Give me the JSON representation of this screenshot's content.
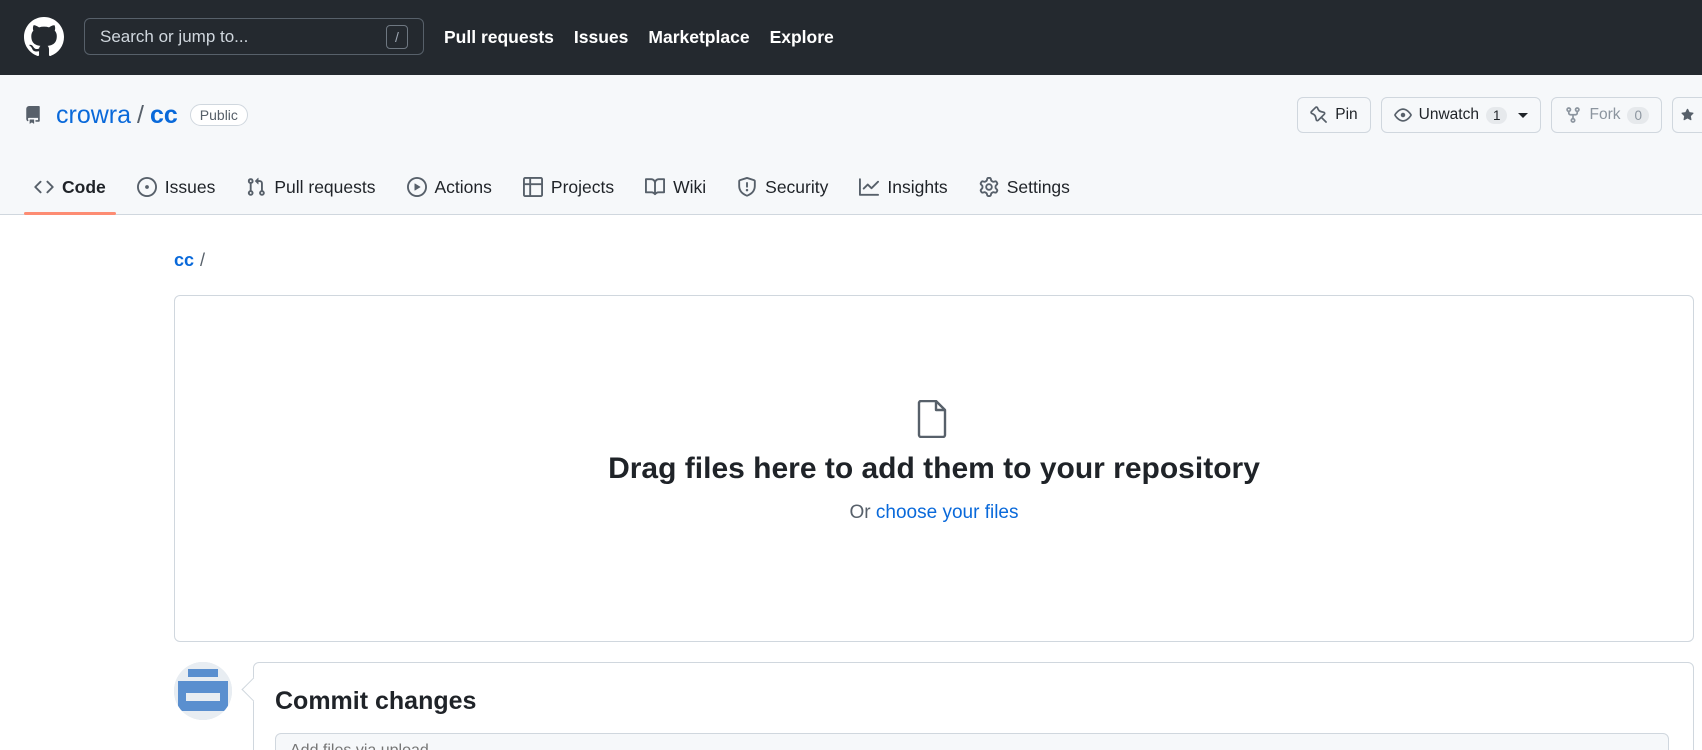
{
  "header": {
    "search_placeholder": "Search or jump to...",
    "search_shortcut": "/",
    "nav": [
      "Pull requests",
      "Issues",
      "Marketplace",
      "Explore"
    ]
  },
  "repo": {
    "owner": "crowra",
    "separator": "/",
    "name": "cc",
    "visibility": "Public",
    "actions": {
      "pin": "Pin",
      "unwatch": "Unwatch",
      "watch_count": "1",
      "fork": "Fork",
      "fork_count": "0"
    },
    "tabs": [
      "Code",
      "Issues",
      "Pull requests",
      "Actions",
      "Projects",
      "Wiki",
      "Security",
      "Insights",
      "Settings"
    ],
    "active_tab": "Code"
  },
  "breadcrumb": {
    "repo": "cc",
    "separator": "/"
  },
  "upload": {
    "title": "Drag files here to add them to your repository",
    "or_text": "Or",
    "choose_link": "choose your files"
  },
  "commit": {
    "title": "Commit changes",
    "summary_placeholder": "Add files via upload"
  },
  "colors": {
    "header_bg": "#24292f",
    "link": "#0969da",
    "tab_underline": "#fd8c73"
  }
}
